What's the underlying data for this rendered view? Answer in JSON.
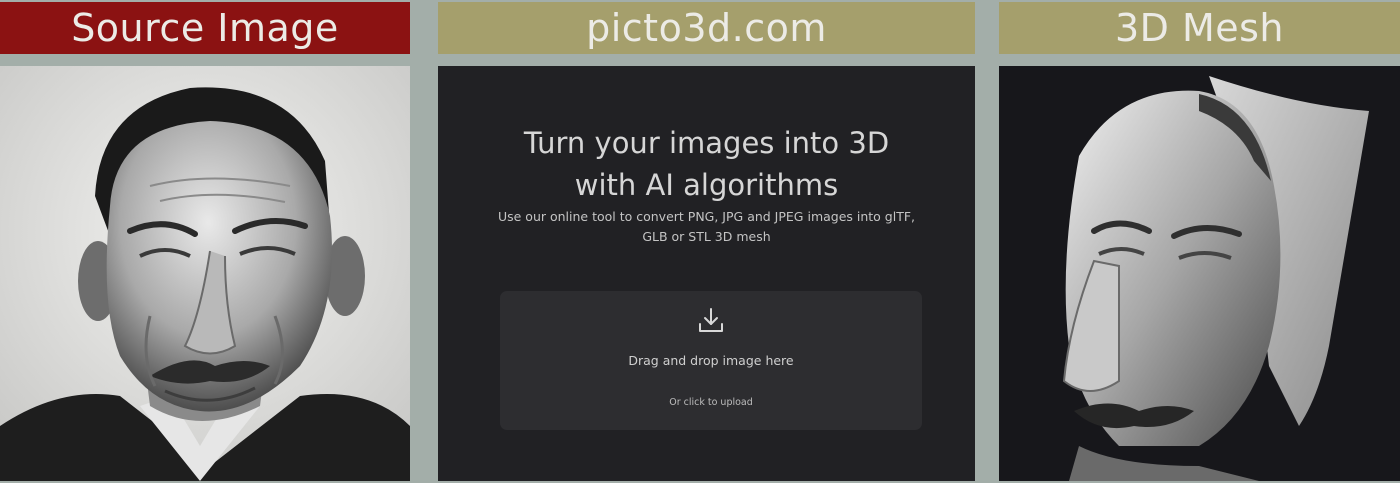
{
  "panels": {
    "source": {
      "title": "Source Image",
      "header_color": "#8b1212"
    },
    "site": {
      "title": "picto3d.com",
      "header_color": "#a59f6c",
      "hero": {
        "title_line1": "Turn your images into 3D",
        "title_line2": "with AI algorithms",
        "subtitle_line1": "Use our online tool to convert PNG, JPG and JPEG images into glTF,",
        "subtitle_line2": "GLB or STL 3D mesh"
      },
      "dropzone": {
        "icon": "download-icon",
        "label": "Drag and drop image here",
        "sublabel": "Or click to upload"
      }
    },
    "mesh": {
      "title": "3D Mesh",
      "header_color": "#a59f6c"
    }
  }
}
